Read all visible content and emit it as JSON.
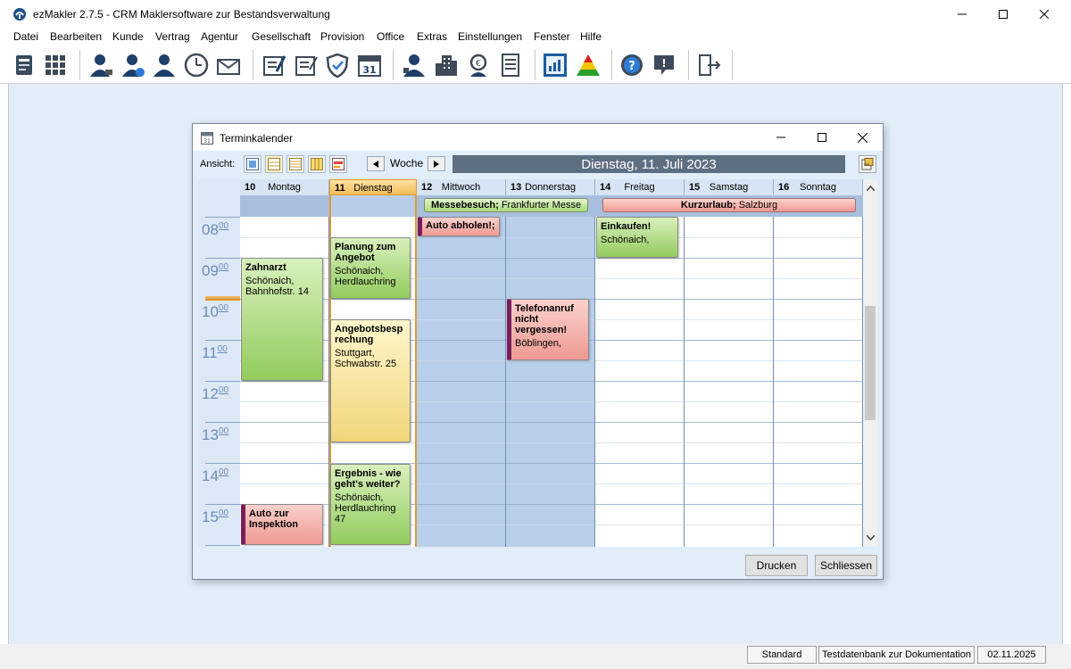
{
  "app": {
    "title": "ezMakler 2.7.5  -  CRM Maklersoftware zur Bestandsverwaltung",
    "menu": [
      "Datei",
      "Bearbeiten",
      "Kunde",
      "Vertrag",
      "Agentur",
      "Gesellschaft",
      "Provision",
      "Office",
      "Extras",
      "Einstellungen",
      "Fenster",
      "Hilfe"
    ],
    "toolbar_icons": [
      "contacts-book-icon",
      "grid-icon",
      "person-edit-icon",
      "person-check-icon",
      "person-icon",
      "clock-icon",
      "mail-icon",
      "contract-edit-icon",
      "contract-icon",
      "shield-icon",
      "calendar-icon",
      "agent-icon",
      "building-icon",
      "commission-icon",
      "document-list-icon",
      "chart-report-icon",
      "traffic-pyramid-icon",
      "help-icon",
      "support-icon",
      "exit-icon"
    ]
  },
  "status": {
    "cells": [
      "Standard",
      "Testdatenbank zur Dokumentation",
      "02.11.2025"
    ]
  },
  "calendar": {
    "window_title": "Terminkalender",
    "view_label": "Ansicht:",
    "nav_label": "Woche",
    "date": "Dienstag, 11. Juli 2023",
    "hours": [
      {
        "h": "08",
        "m": "00"
      },
      {
        "h": "09",
        "m": "00"
      },
      {
        "h": "10",
        "m": "00"
      },
      {
        "h": "11",
        "m": "00"
      },
      {
        "h": "12",
        "m": "00"
      },
      {
        "h": "13",
        "m": "00"
      },
      {
        "h": "14",
        "m": "00"
      },
      {
        "h": "15",
        "m": "00"
      }
    ],
    "days": [
      {
        "num": "10",
        "name": "Montag"
      },
      {
        "num": "11",
        "name": "Dienstag"
      },
      {
        "num": "12",
        "name": "Mittwoch"
      },
      {
        "num": "13",
        "name": "Donnerstag"
      },
      {
        "num": "14",
        "name": "Freitag"
      },
      {
        "num": "15",
        "name": "Samstag"
      },
      {
        "num": "16",
        "name": "Sonntag"
      }
    ],
    "allday_events": [
      {
        "title": "Messebesuch;",
        "detail": "Frankfurter Messe"
      },
      {
        "title": "Kurzurlaub;",
        "detail": "Salzburg"
      }
    ],
    "events": [
      {
        "title": "Zahnarzt",
        "location": "Schönaich, Bahnhofstr. 14"
      },
      {
        "title": "Auto zur Inspektion",
        "location": ""
      },
      {
        "title": "Planung zum Angebot",
        "location": "Schönaich, Herdlauchring"
      },
      {
        "title": "Angebotsbesprechung",
        "location": "Stuttgart, Schwabstr. 25"
      },
      {
        "title": "Ergebnis - wie geht's weiter?",
        "location": "Schönaich, Herdlauchring 47"
      },
      {
        "title": "Auto abholen!;",
        "location": ""
      },
      {
        "title": "Telefonanruf nicht vergessen!",
        "location": "Böblingen,"
      },
      {
        "title": "Einkaufen!",
        "location": "Schönaich,"
      }
    ],
    "buttons": {
      "print": "Drucken",
      "close": "Schliessen"
    }
  }
}
